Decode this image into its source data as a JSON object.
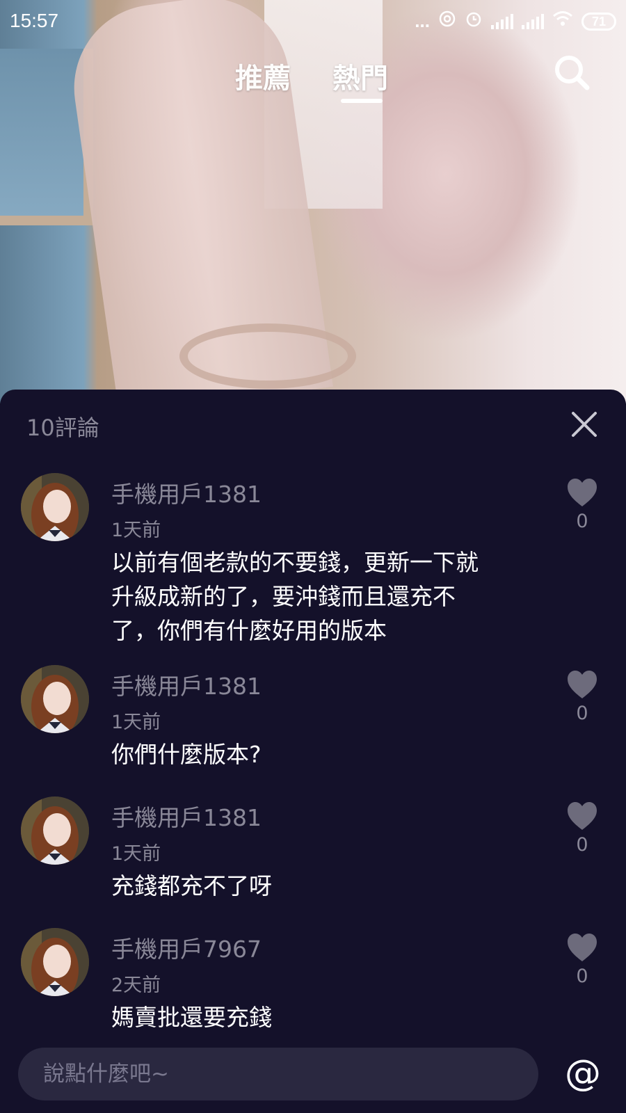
{
  "status_bar": {
    "time": "15:57",
    "dots": "...",
    "battery": "71"
  },
  "tabs": [
    {
      "label": "推薦",
      "active": false
    },
    {
      "label": "熱門",
      "active": true
    }
  ],
  "comments_panel": {
    "title": "10評論",
    "comments": [
      {
        "user": "手機用戶1381",
        "time": "1天前",
        "text": "以前有個老款的不要錢，更新一下就升級成新的了，要沖錢而且還充不了，你們有什麼好用的版本",
        "likes": "0"
      },
      {
        "user": "手機用戶1381",
        "time": "1天前",
        "text": "你們什麼版本?",
        "likes": "0"
      },
      {
        "user": "手機用戶1381",
        "time": "1天前",
        "text": "充錢都充不了呀",
        "likes": "0"
      },
      {
        "user": "手機用戶7967",
        "time": "2天前",
        "text": "媽賣批還要充錢",
        "likes": "0"
      }
    ]
  },
  "input": {
    "placeholder": "說點什麼吧~",
    "mention_symbol": "@"
  },
  "icons": {
    "search": "search-icon",
    "close": "close-icon",
    "like": "heart-icon",
    "mention": "at-icon"
  },
  "colors": {
    "panel_bg": "#14112a",
    "muted_text": "#8a8898",
    "heart": "#6d6b7c",
    "input_bg": "#2a2840"
  }
}
